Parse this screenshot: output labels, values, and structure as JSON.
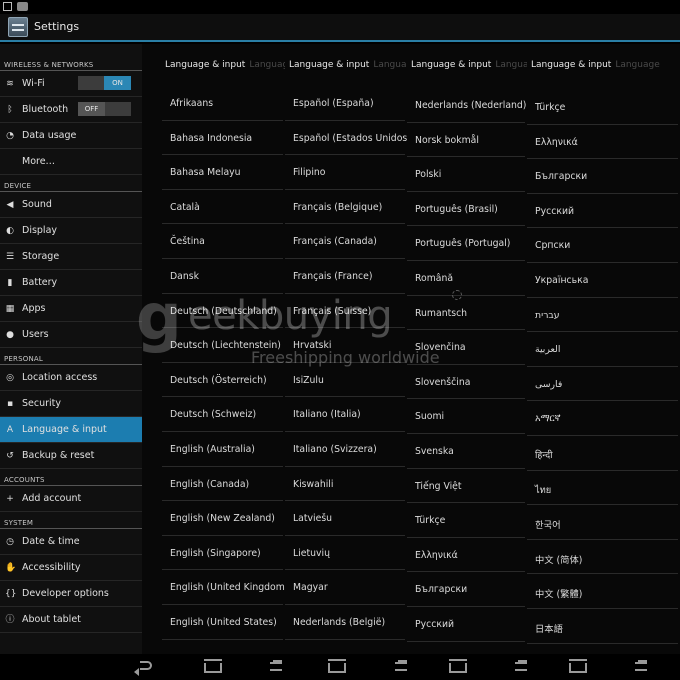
{
  "app": {
    "title": "Settings"
  },
  "sidebar": {
    "sections": [
      {
        "header": "WIRELESS & NETWORKS",
        "items": [
          {
            "label": "Wi-Fi",
            "icon": "wifi-icon",
            "glyph": "≋",
            "toggle": "ON"
          },
          {
            "label": "Bluetooth",
            "icon": "bluetooth-icon",
            "glyph": "ᛒ",
            "toggle": "OFF"
          },
          {
            "label": "Data usage",
            "icon": "data-usage-icon",
            "glyph": "◔"
          },
          {
            "label": "More…",
            "icon": "",
            "glyph": ""
          }
        ]
      },
      {
        "header": "DEVICE",
        "items": [
          {
            "label": "Sound",
            "icon": "sound-icon",
            "glyph": "◀"
          },
          {
            "label": "Display",
            "icon": "display-icon",
            "glyph": "◐"
          },
          {
            "label": "Storage",
            "icon": "storage-icon",
            "glyph": "☰"
          },
          {
            "label": "Battery",
            "icon": "battery-icon",
            "glyph": "▮"
          },
          {
            "label": "Apps",
            "icon": "apps-icon",
            "glyph": "▦"
          },
          {
            "label": "Users",
            "icon": "users-icon",
            "glyph": "●"
          }
        ]
      },
      {
        "header": "PERSONAL",
        "items": [
          {
            "label": "Location access",
            "icon": "location-icon",
            "glyph": "◎"
          },
          {
            "label": "Security",
            "icon": "lock-icon",
            "glyph": "▪"
          },
          {
            "label": "Language & input",
            "icon": "language-icon",
            "glyph": "A",
            "selected": true
          },
          {
            "label": "Backup & reset",
            "icon": "backup-icon",
            "glyph": "↺"
          }
        ]
      },
      {
        "header": "ACCOUNTS",
        "items": [
          {
            "label": "Add account",
            "icon": "plus-icon",
            "glyph": "+"
          }
        ]
      },
      {
        "header": "SYSTEM",
        "items": [
          {
            "label": "Date & time",
            "icon": "clock-icon",
            "glyph": "◷"
          },
          {
            "label": "Accessibility",
            "icon": "hand-icon",
            "glyph": "✋"
          },
          {
            "label": "Developer options",
            "icon": "braces-icon",
            "glyph": "{}"
          },
          {
            "label": "About tablet",
            "icon": "info-icon",
            "glyph": "ⓘ"
          }
        ]
      }
    ]
  },
  "panels": [
    {
      "title": "Language & input",
      "ghost": "Language",
      "items": [
        "Afrikaans",
        "Bahasa Indonesia",
        "Bahasa Melayu",
        "Català",
        "Čeština",
        "Dansk",
        "Deutsch (Deutschland)",
        "Deutsch (Liechtenstein)",
        "Deutsch (Österreich)",
        "Deutsch (Schweiz)",
        "English (Australia)",
        "English (Canada)",
        "English (New Zealand)",
        "English (Singapore)",
        "English (United Kingdom)",
        "English (United States)"
      ]
    },
    {
      "title": "Language & input",
      "ghost": "Language",
      "items": [
        "Español (España)",
        "Español (Estados Unidos)",
        "Filipino",
        "Français (Belgique)",
        "Français (Canada)",
        "Français (France)",
        "Français (Suisse)",
        "Hrvatski",
        "IsiZulu",
        "Italiano (Italia)",
        "Italiano (Svizzera)",
        "Kiswahili",
        "Latviešu",
        "Lietuvių",
        "Magyar",
        "Nederlands (België)"
      ]
    },
    {
      "title": "Language & input",
      "ghost": "Language",
      "items": [
        "Nederlands (Nederland)",
        "Norsk bokmål",
        "Polski",
        "Português (Brasil)",
        "Português (Portugal)",
        "Română",
        "Rumantsch",
        "Slovenčina",
        "Slovenščina",
        "Suomi",
        "Svenska",
        "Tiếng Việt",
        "Türkçe",
        "Ελληνικά",
        "Български",
        "Русский"
      ]
    },
    {
      "title": "Language & input",
      "ghost": "Language",
      "items": [
        "Türkçe",
        "Ελληνικά",
        "Български",
        "Русский",
        "Српски",
        "Українська",
        "עברית",
        "العربية",
        "فارسی",
        "አማርኛ",
        "हिन्दी",
        "ไทย",
        "한국어",
        "中文 (简体)",
        "中文 (繁體)",
        "日本語"
      ]
    }
  ],
  "watermark": {
    "brand": "eekbuying",
    "tagline": "Freeshipping worldwide",
    "letter": "g"
  }
}
